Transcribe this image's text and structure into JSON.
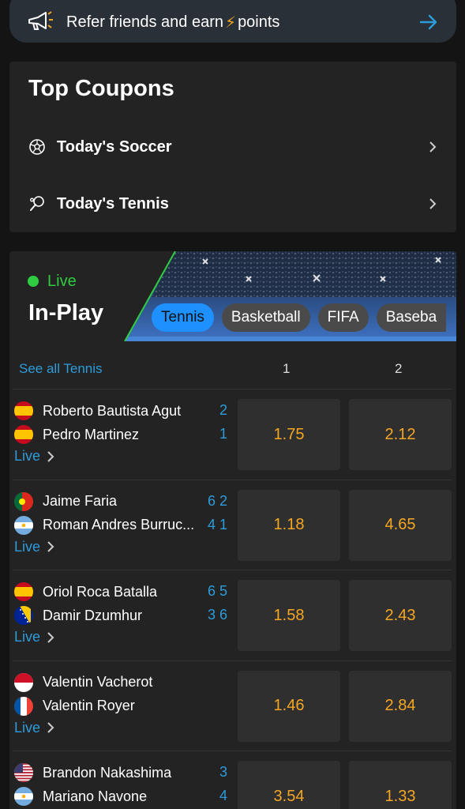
{
  "refer": {
    "text_before": "Refer friends and earn",
    "text_after": "points",
    "icon": "megaphone-icon",
    "arrow_icon": "arrow-right-icon"
  },
  "coupons": {
    "title": "Top Coupons",
    "items": [
      {
        "label": "Today's Soccer",
        "icon": "soccer-ball-icon"
      },
      {
        "label": "Today's Tennis",
        "icon": "tennis-racket-icon"
      }
    ]
  },
  "inplay": {
    "live_label": "Live",
    "title": "In-Play",
    "tabs": [
      "Tennis",
      "Basketball",
      "FIFA",
      "Baseba"
    ],
    "active_tab": "Tennis",
    "see_all": "See all Tennis",
    "col1": "1",
    "col2": "2",
    "matches": [
      {
        "p1": "Roberto Bautista Agut",
        "f1": "spain",
        "s1": "2",
        "p2": "Pedro Martinez",
        "f2": "spain",
        "s2": "1",
        "status": "Live",
        "o1": "1.75",
        "o2": "2.12"
      },
      {
        "p1": "Jaime Faria",
        "f1": "portugal",
        "s1": "6 2",
        "p2": "Roman Andres Burruc...",
        "f2": "argentina",
        "s2": "4 1",
        "status": "Live",
        "o1": "1.18",
        "o2": "4.65"
      },
      {
        "p1": "Oriol Roca Batalla",
        "f1": "spain",
        "s1": "6 5",
        "p2": "Damir Dzumhur",
        "f2": "bosnia",
        "s2": "3 6",
        "status": "Live",
        "o1": "1.58",
        "o2": "2.43"
      },
      {
        "p1": "Valentin Vacherot",
        "f1": "monaco",
        "s1": "",
        "p2": "Valentin Royer",
        "f2": "france",
        "s2": "",
        "status": "Live",
        "o1": "1.46",
        "o2": "2.84"
      },
      {
        "p1": "Brandon Nakashima",
        "f1": "usa",
        "s1": "3",
        "p2": "Mariano Navone",
        "f2": "argentina",
        "s2": "4",
        "status": "Live",
        "o1": "3.54",
        "o2": "1.33"
      }
    ]
  },
  "colors": {
    "accent_blue": "#2d9cdb",
    "odds_orange": "#f5a623",
    "live_green": "#2ecc40",
    "tab_active": "#1e90ff"
  }
}
